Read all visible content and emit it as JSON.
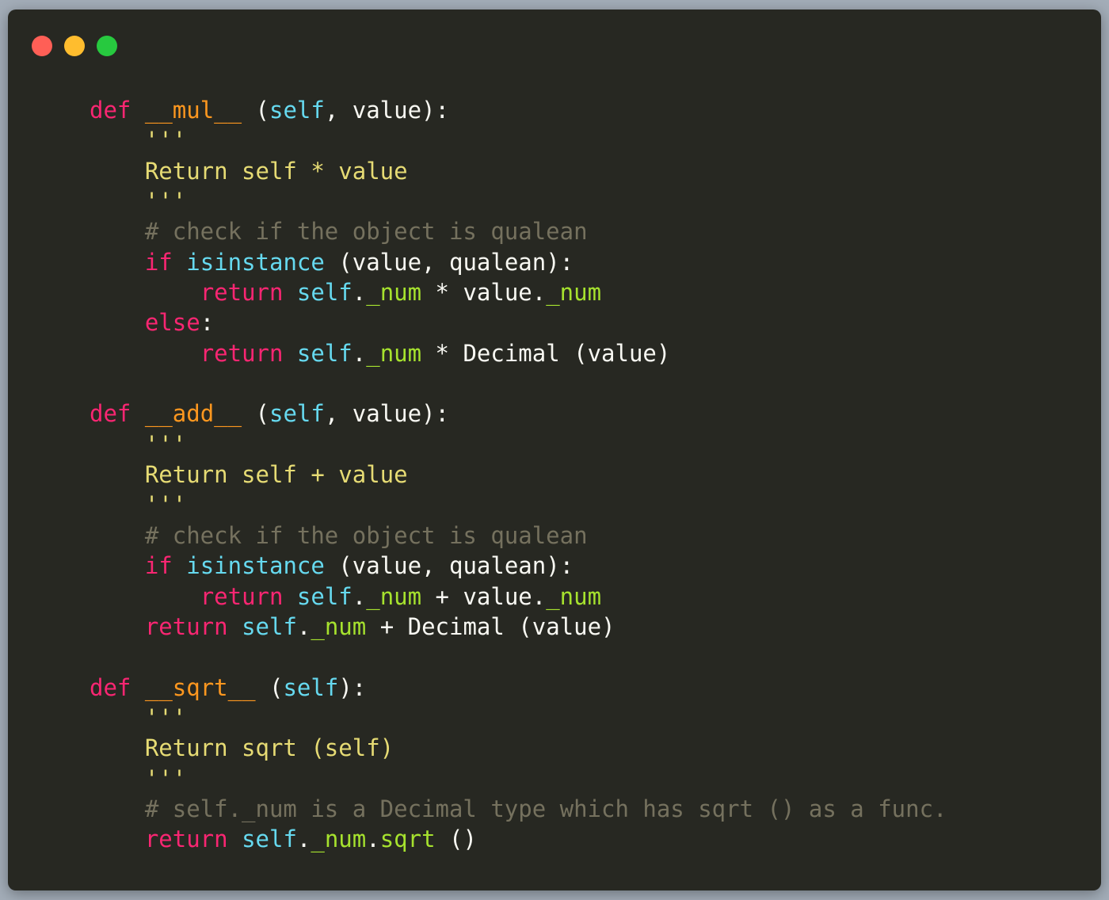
{
  "window": {
    "controls": [
      {
        "name": "close-button",
        "color": "#ff5f56"
      },
      {
        "name": "minimize-button",
        "color": "#ffbd2e"
      },
      {
        "name": "zoom-button",
        "color": "#27c93f"
      }
    ]
  },
  "theme": {
    "keyword": "#f92672",
    "function_name": "#fd971f",
    "builtin": "#66d9ef",
    "string": "#e6db74",
    "comment": "#75715e",
    "attribute": "#a6e22e",
    "plain": "#f8f8f2",
    "background": "#272822"
  },
  "code": {
    "lines": [
      [
        {
          "t": "def",
          "c": "keyword"
        },
        {
          "t": " ",
          "c": "plain"
        },
        {
          "t": "__mul__",
          "c": "function_name"
        },
        {
          "t": " (",
          "c": "plain"
        },
        {
          "t": "self",
          "c": "builtin"
        },
        {
          "t": ", value):",
          "c": "plain"
        }
      ],
      [
        {
          "t": "    '''",
          "c": "string"
        }
      ],
      [
        {
          "t": "    Return self * value",
          "c": "string"
        }
      ],
      [
        {
          "t": "    '''",
          "c": "string"
        }
      ],
      [
        {
          "t": "    # check if the object is qualean",
          "c": "comment"
        }
      ],
      [
        {
          "t": "    ",
          "c": "plain"
        },
        {
          "t": "if",
          "c": "keyword"
        },
        {
          "t": " ",
          "c": "plain"
        },
        {
          "t": "isinstance",
          "c": "builtin"
        },
        {
          "t": " (value, qualean):",
          "c": "plain"
        }
      ],
      [
        {
          "t": "        ",
          "c": "plain"
        },
        {
          "t": "return",
          "c": "keyword"
        },
        {
          "t": " ",
          "c": "plain"
        },
        {
          "t": "self",
          "c": "builtin"
        },
        {
          "t": ".",
          "c": "plain"
        },
        {
          "t": "_num",
          "c": "attribute"
        },
        {
          "t": " * value.",
          "c": "plain"
        },
        {
          "t": "_num",
          "c": "attribute"
        }
      ],
      [
        {
          "t": "    ",
          "c": "plain"
        },
        {
          "t": "else",
          "c": "keyword"
        },
        {
          "t": ":",
          "c": "plain"
        }
      ],
      [
        {
          "t": "        ",
          "c": "plain"
        },
        {
          "t": "return",
          "c": "keyword"
        },
        {
          "t": " ",
          "c": "plain"
        },
        {
          "t": "self",
          "c": "builtin"
        },
        {
          "t": ".",
          "c": "plain"
        },
        {
          "t": "_num",
          "c": "attribute"
        },
        {
          "t": " * Decimal (value)",
          "c": "plain"
        }
      ],
      [],
      [
        {
          "t": "def",
          "c": "keyword"
        },
        {
          "t": " ",
          "c": "plain"
        },
        {
          "t": "__add__",
          "c": "function_name"
        },
        {
          "t": " (",
          "c": "plain"
        },
        {
          "t": "self",
          "c": "builtin"
        },
        {
          "t": ", value):",
          "c": "plain"
        }
      ],
      [
        {
          "t": "    '''",
          "c": "string"
        }
      ],
      [
        {
          "t": "    Return self + value",
          "c": "string"
        }
      ],
      [
        {
          "t": "    '''",
          "c": "string"
        }
      ],
      [
        {
          "t": "    # check if the object is qualean",
          "c": "comment"
        }
      ],
      [
        {
          "t": "    ",
          "c": "plain"
        },
        {
          "t": "if",
          "c": "keyword"
        },
        {
          "t": " ",
          "c": "plain"
        },
        {
          "t": "isinstance",
          "c": "builtin"
        },
        {
          "t": " (value, qualean):",
          "c": "plain"
        }
      ],
      [
        {
          "t": "        ",
          "c": "plain"
        },
        {
          "t": "return",
          "c": "keyword"
        },
        {
          "t": " ",
          "c": "plain"
        },
        {
          "t": "self",
          "c": "builtin"
        },
        {
          "t": ".",
          "c": "plain"
        },
        {
          "t": "_num",
          "c": "attribute"
        },
        {
          "t": " + value.",
          "c": "plain"
        },
        {
          "t": "_num",
          "c": "attribute"
        }
      ],
      [
        {
          "t": "    ",
          "c": "plain"
        },
        {
          "t": "return",
          "c": "keyword"
        },
        {
          "t": " ",
          "c": "plain"
        },
        {
          "t": "self",
          "c": "builtin"
        },
        {
          "t": ".",
          "c": "plain"
        },
        {
          "t": "_num",
          "c": "attribute"
        },
        {
          "t": " + Decimal (value)",
          "c": "plain"
        }
      ],
      [],
      [
        {
          "t": "def",
          "c": "keyword"
        },
        {
          "t": " ",
          "c": "plain"
        },
        {
          "t": "__sqrt__",
          "c": "function_name"
        },
        {
          "t": " (",
          "c": "plain"
        },
        {
          "t": "self",
          "c": "builtin"
        },
        {
          "t": "):",
          "c": "plain"
        }
      ],
      [
        {
          "t": "    '''",
          "c": "string"
        }
      ],
      [
        {
          "t": "    Return sqrt (self)",
          "c": "string"
        }
      ],
      [
        {
          "t": "    '''",
          "c": "string"
        }
      ],
      [
        {
          "t": "    # self._num is a Decimal type which has sqrt () as a func.",
          "c": "comment"
        }
      ],
      [
        {
          "t": "    ",
          "c": "plain"
        },
        {
          "t": "return",
          "c": "keyword"
        },
        {
          "t": " ",
          "c": "plain"
        },
        {
          "t": "self",
          "c": "builtin"
        },
        {
          "t": ".",
          "c": "plain"
        },
        {
          "t": "_num",
          "c": "attribute"
        },
        {
          "t": ".",
          "c": "plain"
        },
        {
          "t": "sqrt",
          "c": "attribute"
        },
        {
          "t": " ()",
          "c": "plain"
        }
      ]
    ]
  }
}
